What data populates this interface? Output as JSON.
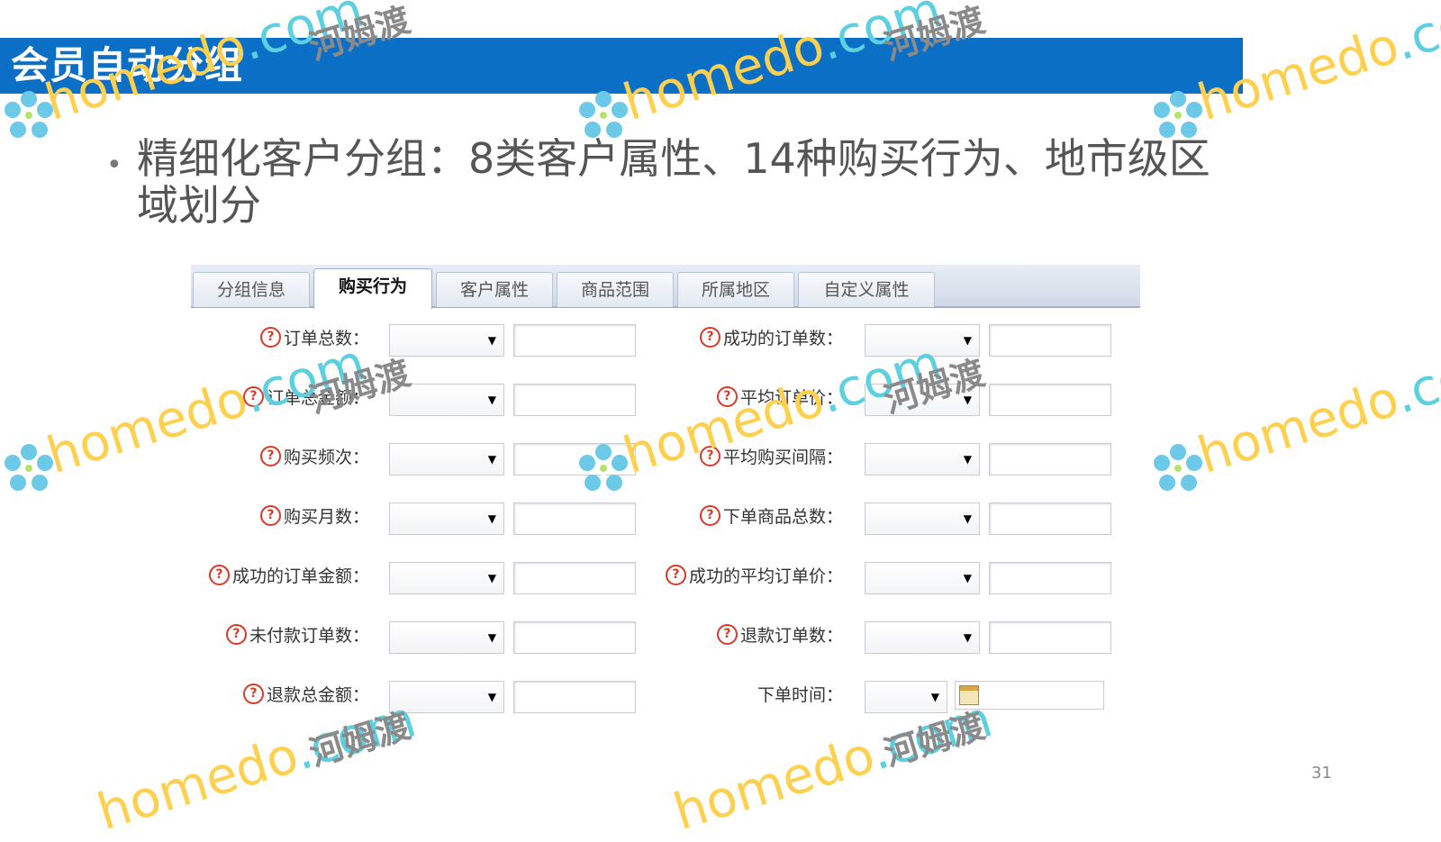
{
  "header": {
    "title": "会员自动分组"
  },
  "bullet": {
    "text": "精细化客户分组：8类客户属性、14种购买行为、地市级区域划分"
  },
  "tabs": [
    {
      "label": "分组信息",
      "active": false
    },
    {
      "label": "购买行为",
      "active": true
    },
    {
      "label": "客户属性",
      "active": false
    },
    {
      "label": "商品范围",
      "active": false
    },
    {
      "label": "所属地区",
      "active": false
    },
    {
      "label": "自定义属性",
      "active": false
    }
  ],
  "left_fields": [
    {
      "label": "订单总数："
    },
    {
      "label": "订单总金额："
    },
    {
      "label": "购买频次："
    },
    {
      "label": "购买月数："
    },
    {
      "label": "成功的订单金额："
    },
    {
      "label": "未付款订单数："
    },
    {
      "label": "退款总金额："
    }
  ],
  "right_fields": [
    {
      "label": "成功的订单数："
    },
    {
      "label": "平均订单价："
    },
    {
      "label": "平均购买间隔："
    },
    {
      "label": "下单商品总数："
    },
    {
      "label": "成功的平均订单价："
    },
    {
      "label": "退款订单数："
    }
  ],
  "order_time": {
    "label": "下单时间："
  },
  "help_icon_glyph": "?",
  "select_arrow": "▼",
  "page_number": "31",
  "watermark": {
    "brand": "homedo",
    "suffix": ".com",
    "cn": "河姆渡"
  },
  "colors": {
    "header_bg": "#0b6fc6",
    "help_icon": "#d83a2a",
    "watermark_brand": "#ffd04d"
  }
}
